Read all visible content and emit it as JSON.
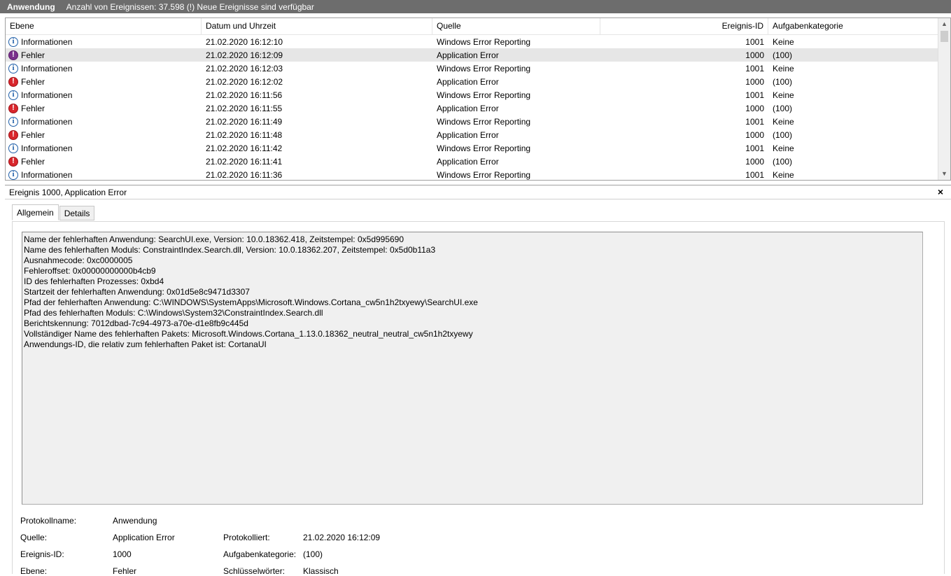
{
  "titlebar": {
    "app_name": "Anwendung",
    "event_count": "Anzahl von Ereignissen: 37.598 (!) Neue Ereignisse sind verfügbar"
  },
  "list": {
    "columns": [
      "Ebene",
      "Datum und Uhrzeit",
      "Quelle",
      "Ereignis-ID",
      "Aufgabenkategorie"
    ],
    "rows": [
      {
        "level": "Informationen",
        "icon": "info-icon",
        "datetime": "21.02.2020 16:12:10",
        "source": "Windows Error Reporting",
        "event_id": "1001",
        "category": "Keine",
        "selected": false
      },
      {
        "level": "Fehler",
        "icon": "error-icon",
        "datetime": "21.02.2020 16:12:09",
        "source": "Application Error",
        "event_id": "1000",
        "category": "(100)",
        "selected": true
      },
      {
        "level": "Informationen",
        "icon": "info-icon",
        "datetime": "21.02.2020 16:12:03",
        "source": "Windows Error Reporting",
        "event_id": "1001",
        "category": "Keine",
        "selected": false
      },
      {
        "level": "Fehler",
        "icon": "error-icon",
        "datetime": "21.02.2020 16:12:02",
        "source": "Application Error",
        "event_id": "1000",
        "category": "(100)",
        "selected": false
      },
      {
        "level": "Informationen",
        "icon": "info-icon",
        "datetime": "21.02.2020 16:11:56",
        "source": "Windows Error Reporting",
        "event_id": "1001",
        "category": "Keine",
        "selected": false
      },
      {
        "level": "Fehler",
        "icon": "error-icon",
        "datetime": "21.02.2020 16:11:55",
        "source": "Application Error",
        "event_id": "1000",
        "category": "(100)",
        "selected": false
      },
      {
        "level": "Informationen",
        "icon": "info-icon",
        "datetime": "21.02.2020 16:11:49",
        "source": "Windows Error Reporting",
        "event_id": "1001",
        "category": "Keine",
        "selected": false
      },
      {
        "level": "Fehler",
        "icon": "error-icon",
        "datetime": "21.02.2020 16:11:48",
        "source": "Application Error",
        "event_id": "1000",
        "category": "(100)",
        "selected": false
      },
      {
        "level": "Informationen",
        "icon": "info-icon",
        "datetime": "21.02.2020 16:11:42",
        "source": "Windows Error Reporting",
        "event_id": "1001",
        "category": "Keine",
        "selected": false
      },
      {
        "level": "Fehler",
        "icon": "error-icon",
        "datetime": "21.02.2020 16:11:41",
        "source": "Application Error",
        "event_id": "1000",
        "category": "(100)",
        "selected": false
      },
      {
        "level": "Informationen",
        "icon": "info-icon",
        "datetime": "21.02.2020 16:11:36",
        "source": "Windows Error Reporting",
        "event_id": "1001",
        "category": "Keine",
        "selected": false
      }
    ]
  },
  "detail": {
    "title": "Ereignis 1000, Application Error",
    "close_glyph": "×",
    "tabs": [
      {
        "label": "Allgemein",
        "active": true
      },
      {
        "label": "Details",
        "active": false
      }
    ],
    "description_lines": [
      "Name der fehlerhaften Anwendung: SearchUI.exe, Version: 10.0.18362.418, Zeitstempel: 0x5d995690",
      "Name des fehlerhaften Moduls: ConstraintIndex.Search.dll, Version: 10.0.18362.207, Zeitstempel: 0x5d0b11a3",
      "Ausnahmecode: 0xc0000005",
      "Fehleroffset: 0x00000000000b4cb9",
      "ID des fehlerhaften Prozesses: 0xbd4",
      "Startzeit der fehlerhaften Anwendung: 0x01d5e8c9471d3307",
      "Pfad der fehlerhaften Anwendung: C:\\WINDOWS\\SystemApps\\Microsoft.Windows.Cortana_cw5n1h2txyewy\\SearchUI.exe",
      "Pfad des fehlerhaften Moduls: C:\\Windows\\System32\\ConstraintIndex.Search.dll",
      "Berichtskennung: 7012dbad-7c94-4973-a70e-d1e8fb9c445d",
      "Vollständiger Name des fehlerhaften Pakets: Microsoft.Windows.Cortana_1.13.0.18362_neutral_neutral_cw5n1h2txyewy",
      "Anwendungs-ID, die relativ zum fehlerhaften Paket ist: CortanaUI"
    ],
    "properties": {
      "protokollname_label": "Protokollname:",
      "protokollname_value": "Anwendung",
      "quelle_label": "Quelle:",
      "quelle_value": "Application Error",
      "protokolliert_label": "Protokolliert:",
      "protokolliert_value": "21.02.2020 16:12:09",
      "ereignis_id_label": "Ereignis-ID:",
      "ereignis_id_value": "1000",
      "aufgabenkategorie_label": "Aufgabenkategorie:",
      "aufgabenkategorie_value": "(100)",
      "ebene_label": "Ebene:",
      "ebene_value": "Fehler",
      "schluesselwoerter_label": "Schlüsselwörter:",
      "schluesselwoerter_value": "Klassisch"
    }
  },
  "colors": {
    "titlebar_bg": "#6d6d6d",
    "selected_row": "#e6e6e6",
    "info_icon": "#1e5ea8",
    "error_icon": "#d9262c",
    "description_bg": "#f0f0f0"
  }
}
